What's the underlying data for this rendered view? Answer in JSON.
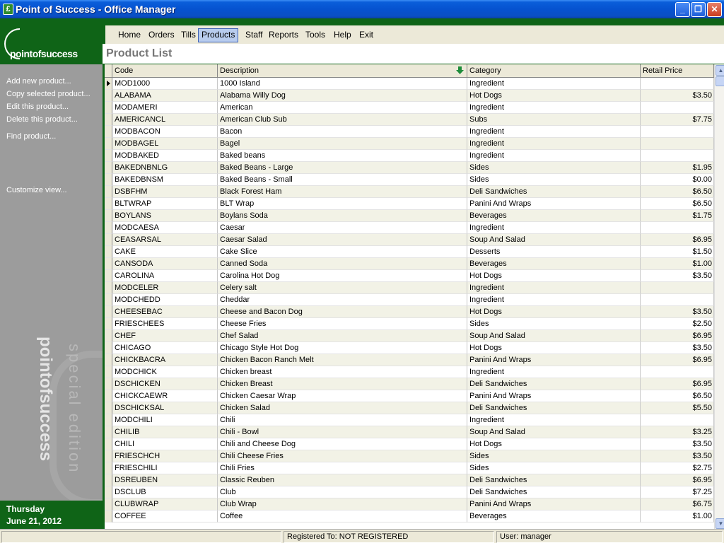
{
  "window": {
    "title": "Point of Success - Office Manager",
    "app_icon_glyph": "£"
  },
  "logo": {
    "brand": "pointofsuccess"
  },
  "sidebar": {
    "actions": [
      {
        "label": "Add new product..."
      },
      {
        "label": "Copy selected product..."
      },
      {
        "label": "Edit this product..."
      },
      {
        "label": "Delete this product..."
      },
      {
        "label": "Find product..."
      },
      {
        "label": "Customize view..."
      }
    ],
    "watermark_line1": "pointofsuccess",
    "watermark_line2": "special edition",
    "date": {
      "day": "Thursday",
      "date": "June 21, 2012"
    }
  },
  "menu": {
    "items": [
      {
        "label": "Home"
      },
      {
        "label": "Orders"
      },
      {
        "label": "Tills"
      },
      {
        "label": "Products"
      },
      {
        "label": "Staff"
      },
      {
        "label": "Reports"
      },
      {
        "label": "Tools"
      },
      {
        "label": "Help"
      },
      {
        "label": "Exit"
      }
    ],
    "active": "Products"
  },
  "page": {
    "title": "Product List"
  },
  "grid": {
    "columns": [
      {
        "label": "Code"
      },
      {
        "label": "Description"
      },
      {
        "label": "Category"
      },
      {
        "label": "Retail Price"
      }
    ],
    "sorted_column": "Description",
    "rows": [
      {
        "code": "MOD1000",
        "desc": "1000 Island",
        "cat": "Ingredient",
        "price": ""
      },
      {
        "code": "ALABAMA",
        "desc": "Alabama Willy Dog",
        "cat": "Hot Dogs",
        "price": "$3.50"
      },
      {
        "code": "MODAMERI",
        "desc": "American",
        "cat": "Ingredient",
        "price": ""
      },
      {
        "code": "AMERICANCL",
        "desc": "American Club Sub",
        "cat": "Subs",
        "price": "$7.75"
      },
      {
        "code": "MODBACON",
        "desc": "Bacon",
        "cat": "Ingredient",
        "price": ""
      },
      {
        "code": "MODBAGEL",
        "desc": "Bagel",
        "cat": "Ingredient",
        "price": ""
      },
      {
        "code": "MODBAKED",
        "desc": "Baked beans",
        "cat": "Ingredient",
        "price": ""
      },
      {
        "code": "BAKEDNBNLG",
        "desc": "Baked Beans - Large",
        "cat": "Sides",
        "price": "$1.95"
      },
      {
        "code": "BAKEDBNSM",
        "desc": "Baked Beans - Small",
        "cat": "Sides",
        "price": "$0.00"
      },
      {
        "code": "DSBFHM",
        "desc": "Black Forest Ham",
        "cat": "Deli Sandwiches",
        "price": "$6.50"
      },
      {
        "code": "BLTWRAP",
        "desc": "BLT Wrap",
        "cat": "Panini And Wraps",
        "price": "$6.50"
      },
      {
        "code": "BOYLANS",
        "desc": "Boylans Soda",
        "cat": "Beverages",
        "price": "$1.75"
      },
      {
        "code": "MODCAESA",
        "desc": "Caesar",
        "cat": "Ingredient",
        "price": ""
      },
      {
        "code": "CEASARSAL",
        "desc": "Caesar Salad",
        "cat": "Soup And Salad",
        "price": "$6.95"
      },
      {
        "code": "CAKE",
        "desc": "Cake Slice",
        "cat": "Desserts",
        "price": "$1.50"
      },
      {
        "code": "CANSODA",
        "desc": "Canned Soda",
        "cat": "Beverages",
        "price": "$1.00"
      },
      {
        "code": "CAROLINA",
        "desc": "Carolina Hot Dog",
        "cat": "Hot Dogs",
        "price": "$3.50"
      },
      {
        "code": "MODCELER",
        "desc": "Celery salt",
        "cat": "Ingredient",
        "price": ""
      },
      {
        "code": "MODCHEDD",
        "desc": "Cheddar",
        "cat": "Ingredient",
        "price": ""
      },
      {
        "code": "CHEESEBAC",
        "desc": "Cheese and Bacon Dog",
        "cat": "Hot Dogs",
        "price": "$3.50"
      },
      {
        "code": "FRIESCHEES",
        "desc": "Cheese Fries",
        "cat": "Sides",
        "price": "$2.50"
      },
      {
        "code": "CHEF",
        "desc": "Chef Salad",
        "cat": "Soup And Salad",
        "price": "$6.95"
      },
      {
        "code": "CHICAGO",
        "desc": "Chicago Style Hot Dog",
        "cat": "Hot Dogs",
        "price": "$3.50"
      },
      {
        "code": "CHICKBACRA",
        "desc": "Chicken Bacon Ranch Melt",
        "cat": "Panini And Wraps",
        "price": "$6.95"
      },
      {
        "code": "MODCHICK",
        "desc": "Chicken breast",
        "cat": "Ingredient",
        "price": ""
      },
      {
        "code": "DSCHICKEN",
        "desc": "Chicken Breast",
        "cat": "Deli Sandwiches",
        "price": "$6.95"
      },
      {
        "code": "CHICKCAEWR",
        "desc": "Chicken Caesar Wrap",
        "cat": "Panini And Wraps",
        "price": "$6.50"
      },
      {
        "code": "DSCHICKSAL",
        "desc": "Chicken Salad",
        "cat": "Deli Sandwiches",
        "price": "$5.50"
      },
      {
        "code": "MODCHILI",
        "desc": "Chili",
        "cat": "Ingredient",
        "price": ""
      },
      {
        "code": "CHILIB",
        "desc": "Chili - Bowl",
        "cat": "Soup And Salad",
        "price": "$3.25"
      },
      {
        "code": "CHILI",
        "desc": "Chili and Cheese Dog",
        "cat": "Hot Dogs",
        "price": "$3.50"
      },
      {
        "code": "FRIESCHCH",
        "desc": "Chili Cheese Fries",
        "cat": "Sides",
        "price": "$3.50"
      },
      {
        "code": "FRIESCHILI",
        "desc": "Chili Fries",
        "cat": "Sides",
        "price": "$2.75"
      },
      {
        "code": "DSREUBEN",
        "desc": "Classic Reuben",
        "cat": "Deli Sandwiches",
        "price": "$6.95"
      },
      {
        "code": "DSCLUB",
        "desc": "Club",
        "cat": "Deli Sandwiches",
        "price": "$7.25"
      },
      {
        "code": "CLUBWRAP",
        "desc": "Club Wrap",
        "cat": "Panini And Wraps",
        "price": "$6.75"
      },
      {
        "code": "COFFEE",
        "desc": "Coffee",
        "cat": "Beverages",
        "price": "$1.00"
      }
    ]
  },
  "status": {
    "registered": "Registered To: NOT REGISTERED",
    "user": "User:  manager"
  },
  "colors": {
    "brand_green": "#0F6417",
    "sidebar_gray": "#9C9C9C",
    "titlebar_blue": "#0652D0"
  },
  "icons": {
    "sort": "green-down-arrow-icon",
    "minimize": "minimize-icon",
    "maximize": "restore-icon",
    "close": "close-icon"
  }
}
